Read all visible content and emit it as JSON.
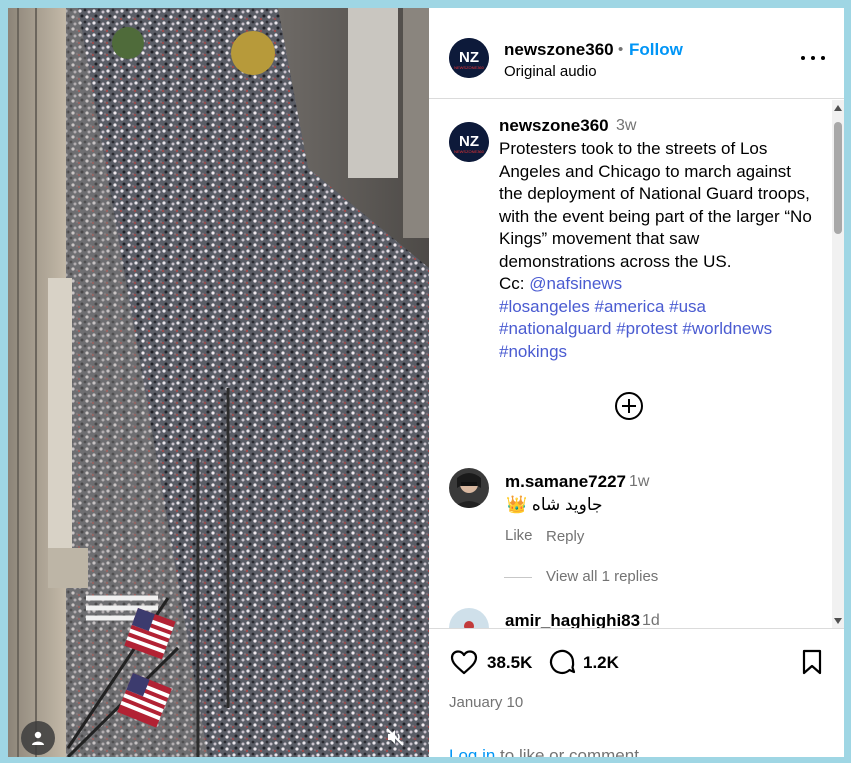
{
  "post": {
    "account": "newszone360",
    "logo_text": "NZ",
    "logo_subtext": "NEWSZONE360",
    "dot": "•",
    "follow_label": "Follow",
    "audio": "Original audio",
    "more_icon": "more-options-icon"
  },
  "caption": {
    "username": "newszone360",
    "time": "3w",
    "text": "Protesters took to the streets of Los Angeles and Chicago to march against the deployment of National Guard troops, with the event being part of the larger “No Kings” movement that saw demonstrations across the US.",
    "cc_label": "Cc:",
    "mention": "@nafsinews",
    "hashtags": [
      "#losangeles",
      "#america",
      "#usa",
      "#nationalguard",
      "#protest",
      "#worldnews",
      "#nokings"
    ]
  },
  "comments": [
    {
      "username": "m.samane7227",
      "time": "1w",
      "emoji": "👑",
      "text": "جاوید شاه",
      "like_label": "Like",
      "reply_label": "Reply",
      "view_replies": "View all 1 replies"
    },
    {
      "username": "amir_haghighi83",
      "time": "1d"
    }
  ],
  "actions": {
    "likes": "38.5K",
    "comments": "1.2K"
  },
  "date": "January 10",
  "login": {
    "link": "Log in",
    "rest": " to like or comment."
  },
  "colors": {
    "accent": "#0095f6",
    "link": "#4a5bd1",
    "muted": "#737373",
    "background": "#9fd6e4"
  }
}
